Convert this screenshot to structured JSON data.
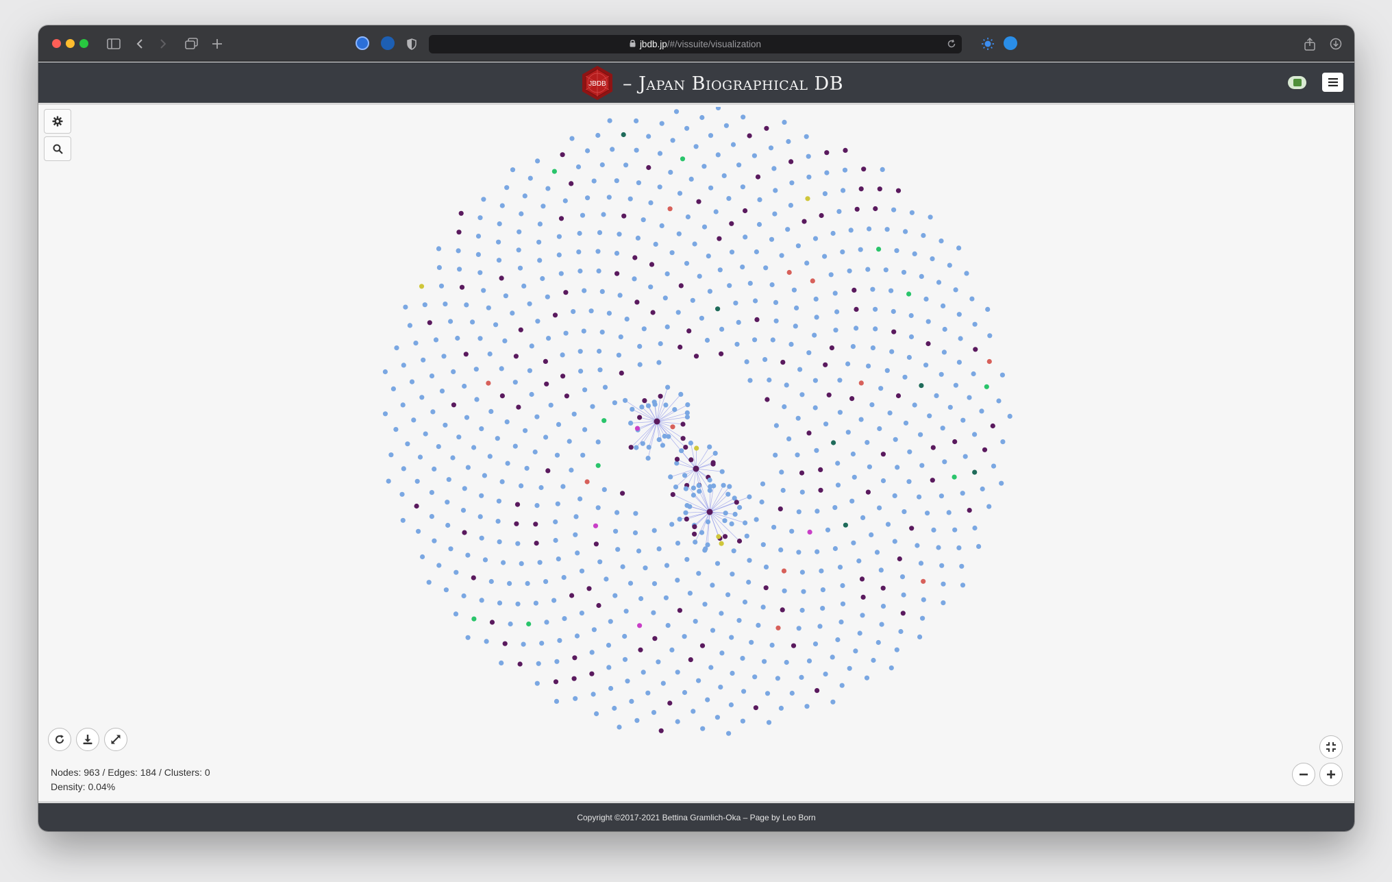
{
  "browser": {
    "url_host": "jbdb.jp",
    "url_path": "/#/vissuite/visualization"
  },
  "site": {
    "logo_text": "JBDB",
    "title": "– Japan Biographical DB"
  },
  "toolbar": {
    "settings_icon": "gear-icon",
    "search_icon": "search-icon"
  },
  "graph_controls": {
    "reload_icon": "refresh-icon",
    "download_icon": "download-icon",
    "expand_icon": "expand-icon",
    "fit_icon": "fit-screen-icon",
    "zoom_out_icon": "minus-icon",
    "zoom_in_icon": "plus-icon"
  },
  "stats": {
    "counts": "Nodes: 963 / Edges: 184 / Clusters: 0",
    "density": "Density: 0.04%"
  },
  "footer": {
    "copyright": "Copyright ©2017-2021 Bettina Gramlich-Oka – Page by Leo Born"
  },
  "colors": {
    "node_default": "#7aa7e2",
    "node_person": "#5a1a5e",
    "node_magenta": "#c93fc7",
    "node_yellow": "#cfc63a",
    "node_red": "#d7605a",
    "node_teal": "#1f6b5a",
    "node_green": "#2ac46b",
    "edge": "#8d95e8",
    "header_bg": "#393c42"
  }
}
